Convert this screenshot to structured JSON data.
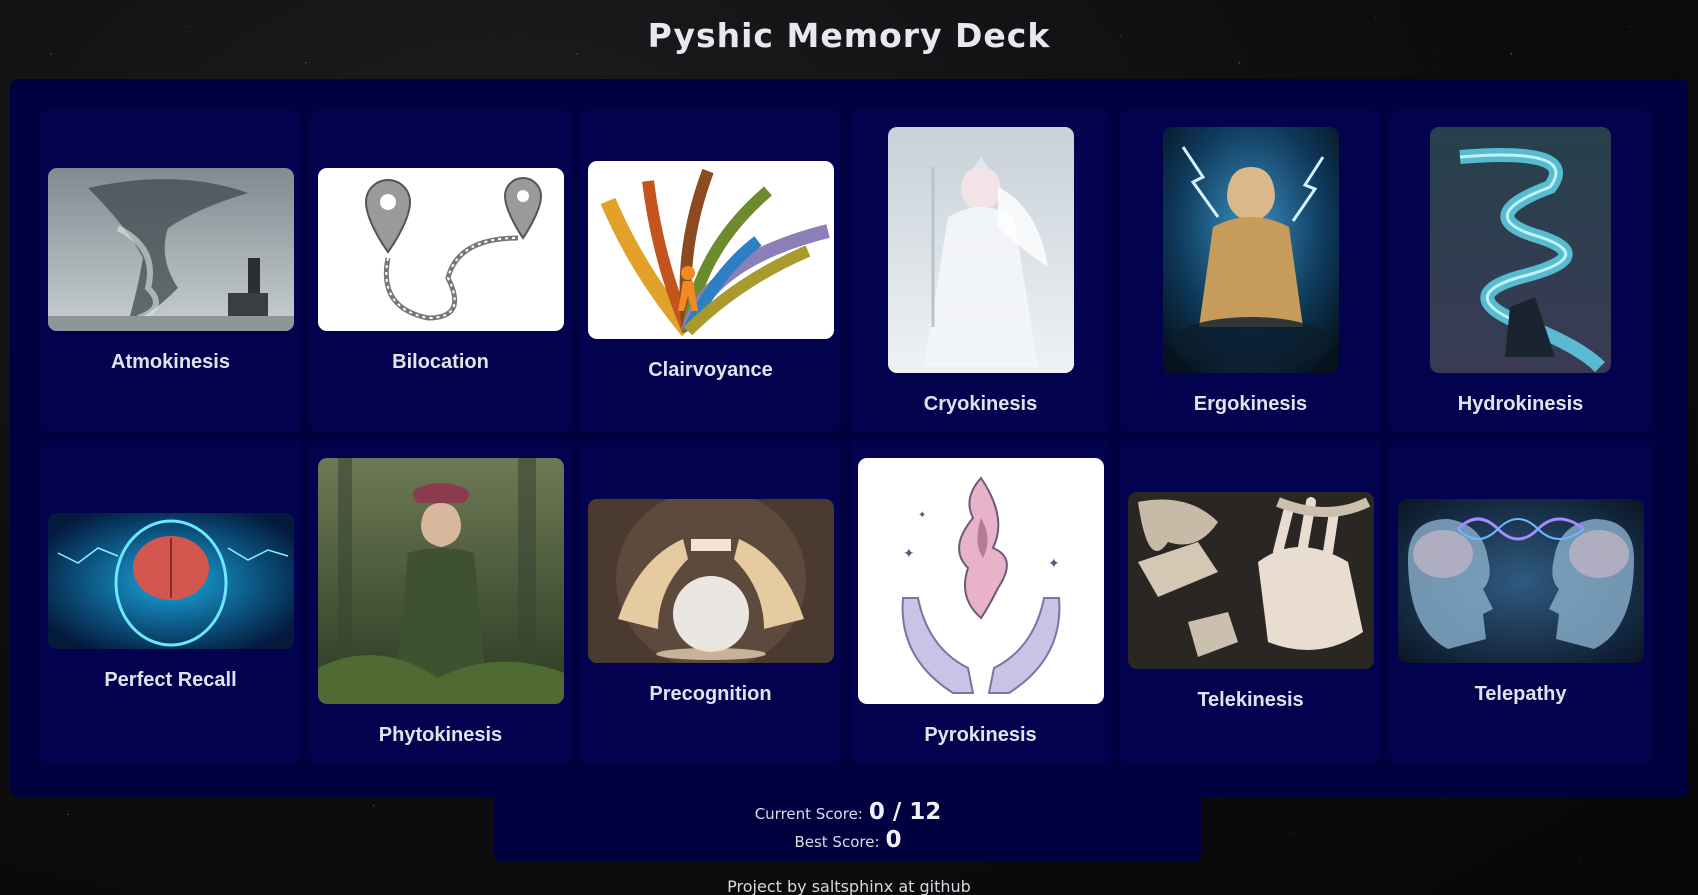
{
  "title": "Pyshic Memory Deck",
  "cards": [
    {
      "label": "Atmokinesis",
      "icon": "tornado-image"
    },
    {
      "label": "Bilocation",
      "icon": "location-pins-image"
    },
    {
      "label": "Clairvoyance",
      "icon": "branching-paths-image"
    },
    {
      "label": "Cryokinesis",
      "icon": "ice-queen-image"
    },
    {
      "label": "Ergokinesis",
      "icon": "lightning-god-image"
    },
    {
      "label": "Hydrokinesis",
      "icon": "water-bender-image"
    },
    {
      "label": "Perfect Recall",
      "icon": "glowing-brain-image"
    },
    {
      "label": "Phytokinesis",
      "icon": "forest-woman-image"
    },
    {
      "label": "Precognition",
      "icon": "crystal-ball-image"
    },
    {
      "label": "Pyrokinesis",
      "icon": "flame-hands-image"
    },
    {
      "label": "Telekinesis",
      "icon": "floating-rocks-hand-image"
    },
    {
      "label": "Telepathy",
      "icon": "two-heads-waves-image"
    }
  ],
  "score": {
    "current_label": "Current Score:",
    "current_value": "0 / 12",
    "best_label": "Best Score:",
    "best_value": "0"
  },
  "footer": "Project by saltsphinx at github",
  "colors": {
    "board": "#010140",
    "card": "#02024e",
    "text": "#e2e2ec"
  }
}
